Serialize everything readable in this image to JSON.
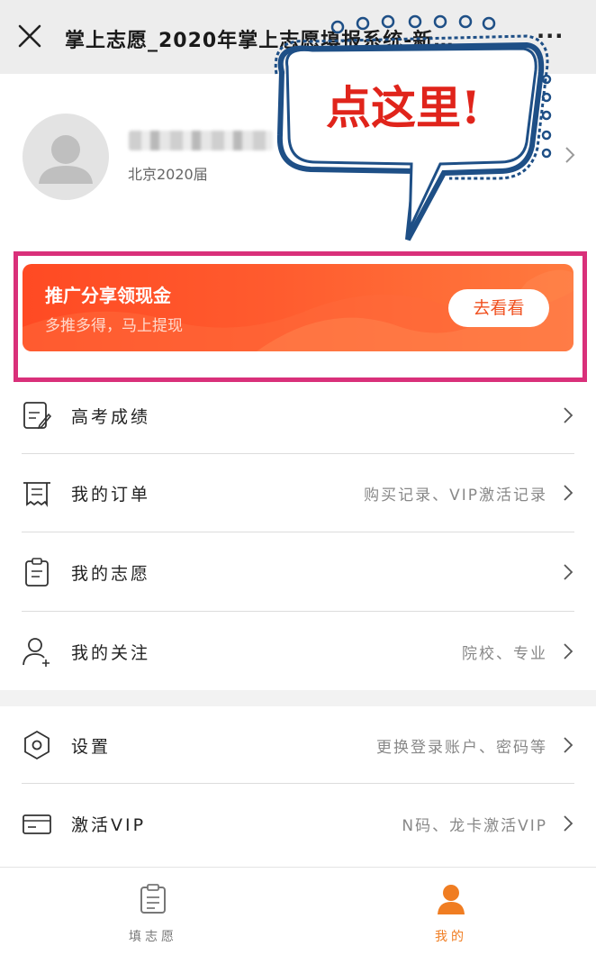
{
  "topbar": {
    "title": "掌上志愿_2020年掌上志愿填报系统-新…",
    "more_label": "···"
  },
  "profile": {
    "subtitle": "北京2020届"
  },
  "annotation": {
    "text": "点这里!"
  },
  "promo": {
    "title": "推广分享领现金",
    "subtitle": "多推多得，马上提现",
    "button_label": "去看看"
  },
  "menu": [
    {
      "label": "高考成绩",
      "hint": "",
      "icon": "exam-score-icon"
    },
    {
      "label": "我的订单",
      "hint": "购买记录、VIP激活记录",
      "icon": "receipt-icon"
    },
    {
      "label": "我的志愿",
      "hint": "",
      "icon": "clipboard-icon"
    },
    {
      "label": "我的关注",
      "hint": "院校、专业",
      "icon": "user-add-icon"
    }
  ],
  "menu2": [
    {
      "label": "设置",
      "hint": "更换登录账户、密码等",
      "icon": "settings-hexagon-icon"
    },
    {
      "label": "激活VIP",
      "hint": "N码、龙卡激活VIP",
      "icon": "card-icon"
    }
  ],
  "tabs": [
    {
      "label": "填志愿",
      "active": false
    },
    {
      "label": "我的",
      "active": true
    }
  ],
  "colors": {
    "accent": "#f07d22",
    "promo": "#ff5b2e",
    "frame": "#d9307a",
    "annotation": "#e0241b"
  }
}
